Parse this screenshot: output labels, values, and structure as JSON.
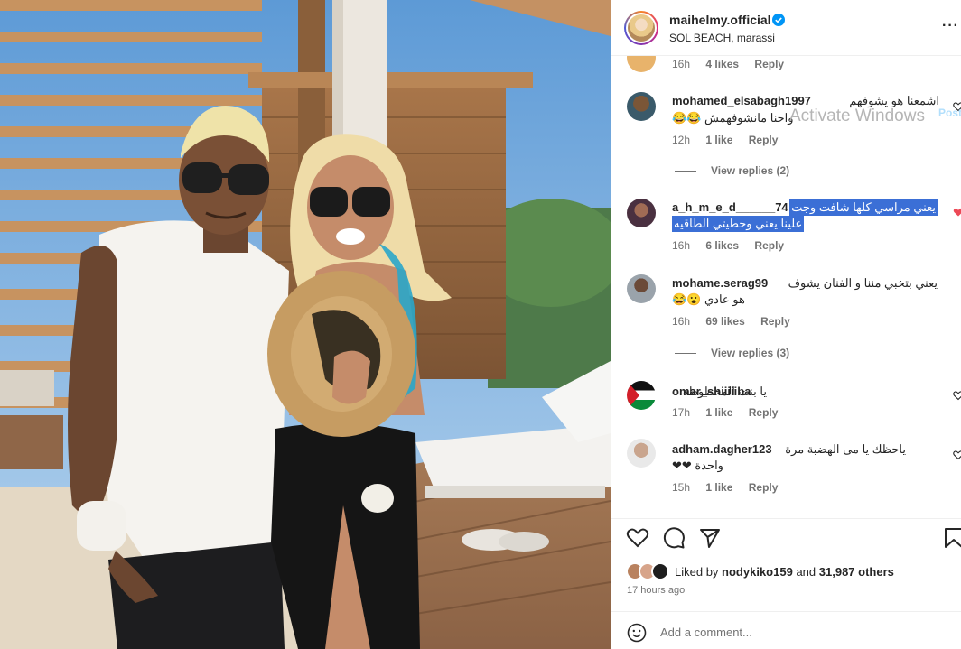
{
  "post": {
    "owner": "maihelmy.official",
    "location": "SOL BEACH, marassi",
    "more_icon": "more-horizontal-icon"
  },
  "comments": [
    {
      "time": "16h",
      "likes": "4 likes",
      "reply": "Reply"
    },
    {
      "user": "mohamed_elsabagh1997",
      "line1": "اشمعنا هو يشوفهم",
      "line2": "واحنا مانشوفهمش 😂😂",
      "time": "12h",
      "likes": "1 like",
      "reply": "Reply",
      "view_replies": "View replies (2)"
    },
    {
      "user": "a_h_m_e_d______74",
      "line1": "يعني مراسي كلها شافت وجت",
      "line2": "علينا يعني وحطيتي الطاقيه",
      "time": "16h",
      "likes": "6 likes",
      "reply": "Reply"
    },
    {
      "user": "mohame.serag99",
      "line1": "يعني بتخبي مننا و الفنان يشوف",
      "line2": "هو عادي 😮😂",
      "time": "16h",
      "likes": "69 likes",
      "reply": "Reply",
      "view_replies": "View replies (3)"
    },
    {
      "user": "omar_shiiiiiba",
      "line1": "يا بنت المحظوظه",
      "time": "17h",
      "likes": "1 like",
      "reply": "Reply"
    },
    {
      "user": "adham.dagher123",
      "line1": "ياحظك يا مى الهضبة مرة",
      "line2": "واحدة ❤❤",
      "time": "15h",
      "likes": "1 like",
      "reply": "Reply"
    }
  ],
  "actions": {
    "liked_by_prefix": "Liked by",
    "liked_by_user": "nodykiko159",
    "liked_and": "and",
    "liked_others": "31,987 others",
    "posted_ago": "17 hours ago",
    "comment_placeholder": "Add a comment...",
    "post_label": "Post"
  },
  "system": {
    "watermark": "Activate Windows"
  },
  "colors": {
    "verified": "#0095f6",
    "like_red": "#ed4956",
    "selection": "#3b6fd6",
    "meta_gray": "#737373"
  }
}
